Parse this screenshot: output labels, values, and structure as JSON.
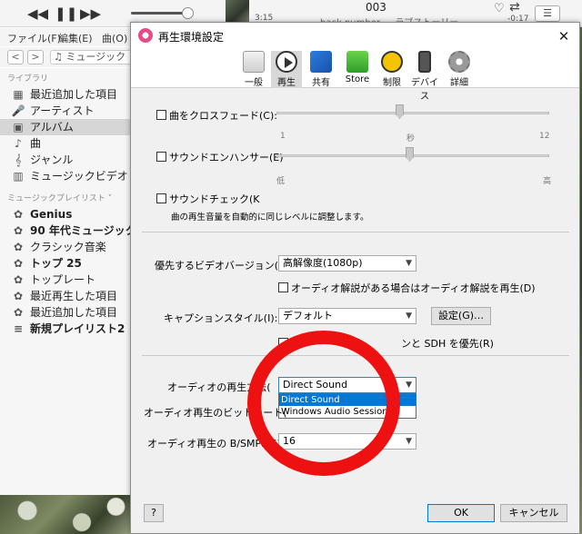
{
  "player": {
    "prev_icon": "◀◀",
    "pause_icon": "❚❚",
    "next_icon": "▶▶",
    "elapsed": "3:15",
    "track_title": "003",
    "artist_line": "back number — ラブストーリー",
    "remaining": "-0:17",
    "heart_icon": "♡",
    "repeat_icon": "⇄",
    "list_icon": "☰"
  },
  "menubar": {
    "file": "ファイル(F)",
    "edit": "編集(E)",
    "song": "曲(O)"
  },
  "nav": {
    "back": "<",
    "forward": ">",
    "media_label": "♫ ミュージック"
  },
  "sidebar": {
    "library_header": "ライブラリ",
    "library_items": [
      {
        "label": "最近追加した項目",
        "icon": "▦"
      },
      {
        "label": "アーティスト",
        "icon": "🎤"
      },
      {
        "label": "アルバム",
        "icon": "▣"
      },
      {
        "label": "曲",
        "icon": "♪"
      },
      {
        "label": "ジャンル",
        "icon": "𝄞"
      },
      {
        "label": "ミュージックビデオ",
        "icon": "▥"
      }
    ],
    "selected_index": 2,
    "playlists_header": "ミュージックプレイリスト ˅",
    "playlist_items": [
      {
        "label": "Genius",
        "icon": "✿",
        "bold": true
      },
      {
        "label": "90 年代ミュージック",
        "icon": "✿",
        "bold": true
      },
      {
        "label": "クラシック音楽",
        "icon": "✿",
        "bold": false
      },
      {
        "label": "トップ 25",
        "icon": "✿",
        "bold": true
      },
      {
        "label": "トップレート",
        "icon": "✿",
        "bold": false
      },
      {
        "label": "最近再生した項目",
        "icon": "✿",
        "bold": false
      },
      {
        "label": "最近追加した項目",
        "icon": "✿",
        "bold": false
      },
      {
        "label": "新規プレイリスト2",
        "icon": "≡",
        "bold": true
      }
    ]
  },
  "dialog": {
    "title": "再生環境設定",
    "close": "✕",
    "tabs": [
      {
        "label": "一般",
        "icon": "general-icon"
      },
      {
        "label": "再生",
        "icon": "play-icon"
      },
      {
        "label": "共有",
        "icon": "share-icon"
      },
      {
        "label": "Store",
        "icon": "store-icon"
      },
      {
        "label": "制限",
        "icon": "restrictions-icon"
      },
      {
        "label": "デバイス",
        "icon": "device-icon"
      },
      {
        "label": "詳細",
        "icon": "advanced-icon"
      }
    ],
    "active_tab_index": 1,
    "crossfade": {
      "label": "曲をクロスフェード(C):",
      "min": "1",
      "unit": "秒",
      "max": "12"
    },
    "sound_enhancer": {
      "label": "サウンドエンハンサー(E)",
      "low": "低",
      "high": "高"
    },
    "sound_check": {
      "label": "サウンドチェック(K",
      "note": "曲の再生音量を自動的に同じレベルに調整します。"
    },
    "video_version": {
      "label": "優先するビデオバージョン(V):",
      "value": "高解像度(1080p)"
    },
    "audio_description": {
      "label": "オーディオ解説がある場合はオーディオ解説を再生(D)"
    },
    "caption_style": {
      "label": "キャプションスタイル(I):",
      "value": "デフォルト",
      "settings_button": "設定(G)…"
    },
    "sdh": {
      "label_start": "…",
      "label_end": "ンと SDH を優先(R)"
    },
    "audio_method": {
      "label": "オーディオの再生方法(",
      "value": "Direct Sound",
      "options": [
        "Direct Sound",
        "Windows Audio Session"
      ],
      "highlighted_index": 0
    },
    "bitrate": {
      "label": "オーディオ再生のビットレート("
    },
    "bits_per_sample": {
      "label": "オーディオ再生の B/SMPL(S)",
      "value": "16"
    },
    "help_button": "?",
    "ok_button": "OK",
    "cancel_button": "キャンセル"
  },
  "colors": {
    "accent": "#0078d7",
    "annotation": "#ee1111"
  }
}
